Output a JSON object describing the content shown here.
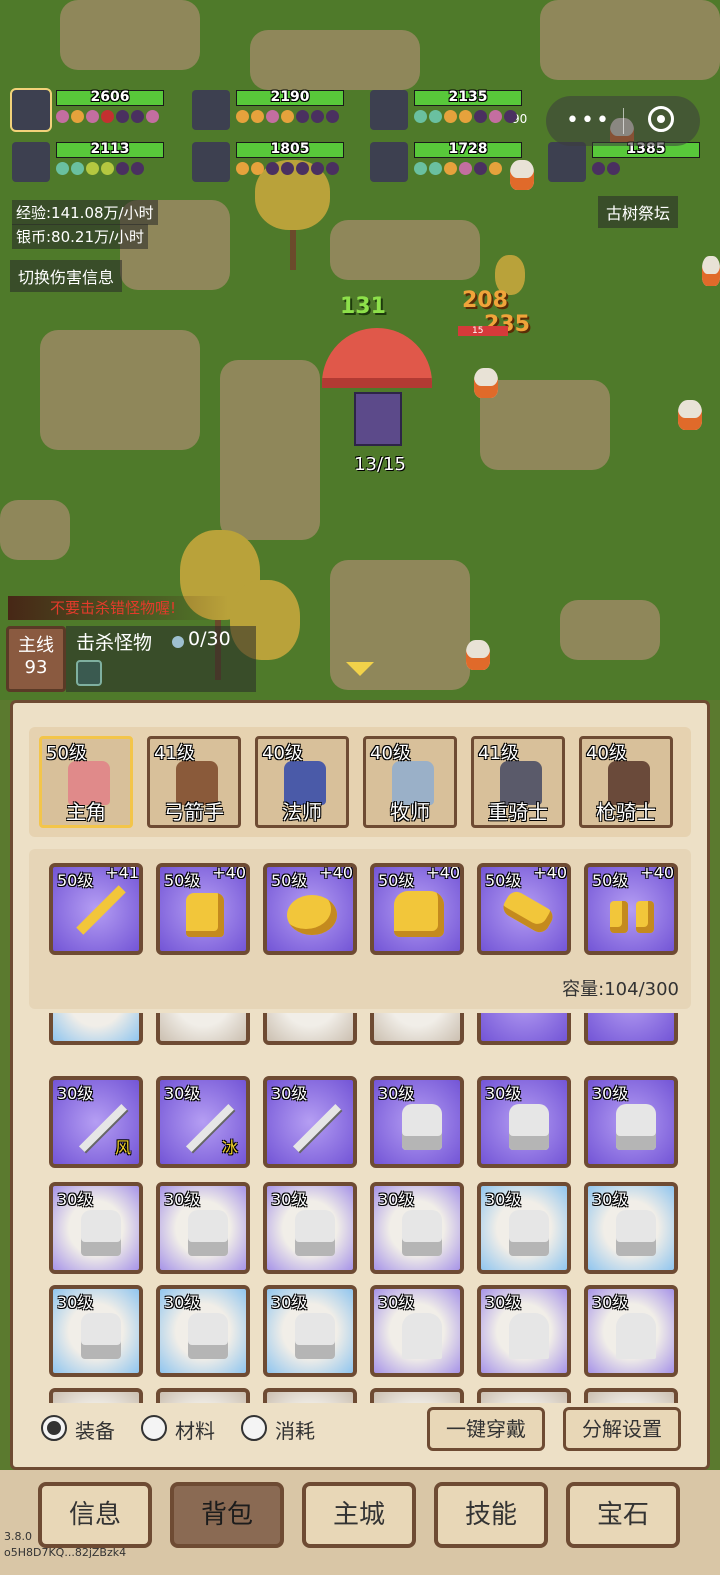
{
  "team": [
    {
      "hp": "2606",
      "selected": true
    },
    {
      "hp": "2190"
    },
    {
      "hp": "2135"
    },
    {
      "hp": "2113"
    },
    {
      "hp": "1805"
    },
    {
      "hp": "1728"
    },
    {
      "hp": "1385"
    }
  ],
  "stats": {
    "exp": "经验:141.08万/小时",
    "silver": "银币:80.21万/小时"
  },
  "toggle_damage": "切换伤害信息",
  "location": "古树祭坛",
  "battle": {
    "damage_numbers": [
      "131",
      "208",
      "235",
      "90",
      "15"
    ],
    "supply_progress": "13/15"
  },
  "quest": {
    "warning": "不要击杀错怪物喔!",
    "main_label": "主线",
    "main_level": "93",
    "task": "击杀怪物",
    "progress": "0/30"
  },
  "heroes": [
    {
      "level": "50级",
      "name": "主角",
      "selected": true
    },
    {
      "level": "41级",
      "name": "弓箭手"
    },
    {
      "level": "40级",
      "name": "法师"
    },
    {
      "level": "40级",
      "name": "牧师"
    },
    {
      "level": "41级",
      "name": "重骑士"
    },
    {
      "level": "40级",
      "name": "枪骑士"
    }
  ],
  "equipped": [
    {
      "level": "50级",
      "plus": "+41",
      "icon": "gold-sword-icon"
    },
    {
      "level": "50级",
      "plus": "+40",
      "icon": "gold-helmet-icon"
    },
    {
      "level": "50级",
      "plus": "+40",
      "icon": "gold-shield-icon"
    },
    {
      "level": "50级",
      "plus": "+40",
      "icon": "gold-armor-icon"
    },
    {
      "level": "50级",
      "plus": "+40",
      "icon": "gold-gauntlet-icon"
    },
    {
      "level": "50级",
      "plus": "+40",
      "icon": "gold-boots-icon"
    }
  ],
  "capacity": "容量:104/300",
  "inventory": {
    "row1": [
      {
        "level": "30级",
        "type": "sword",
        "element": "风"
      },
      {
        "level": "30级",
        "type": "sword",
        "element": "冰"
      },
      {
        "level": "30级",
        "type": "sword"
      },
      {
        "level": "30级",
        "type": "armor"
      },
      {
        "level": "30级",
        "type": "armor"
      },
      {
        "level": "30级",
        "type": "armor"
      }
    ],
    "row2": [
      {
        "level": "30级",
        "type": "armor"
      },
      {
        "level": "30级",
        "type": "armor"
      },
      {
        "level": "30级",
        "type": "armor"
      },
      {
        "level": "30级",
        "type": "armor"
      },
      {
        "level": "30级",
        "type": "armor"
      },
      {
        "level": "30级",
        "type": "armor"
      }
    ],
    "row3": [
      {
        "level": "30级",
        "type": "armor"
      },
      {
        "level": "30级",
        "type": "armor"
      },
      {
        "level": "30级",
        "type": "armor"
      },
      {
        "level": "30级",
        "type": "robe"
      },
      {
        "level": "30级",
        "type": "robe"
      },
      {
        "level": "30级",
        "type": "robe"
      }
    ]
  },
  "filters": [
    "装备",
    "材料",
    "消耗"
  ],
  "actions": {
    "equip_all": "一键穿戴",
    "decompose": "分解设置"
  },
  "nav": [
    "信息",
    "背包",
    "主城",
    "技能",
    "宝石"
  ],
  "version": "3.8.0",
  "build_id": "o5H8D7KQ...82jZBzk4",
  "colors": {
    "panel_bg": "#ede0c6",
    "border": "#6e4b33",
    "hp_green": "#58c83a",
    "purple_rarity": "#7355d6",
    "warning_red": "#e23b2b"
  }
}
